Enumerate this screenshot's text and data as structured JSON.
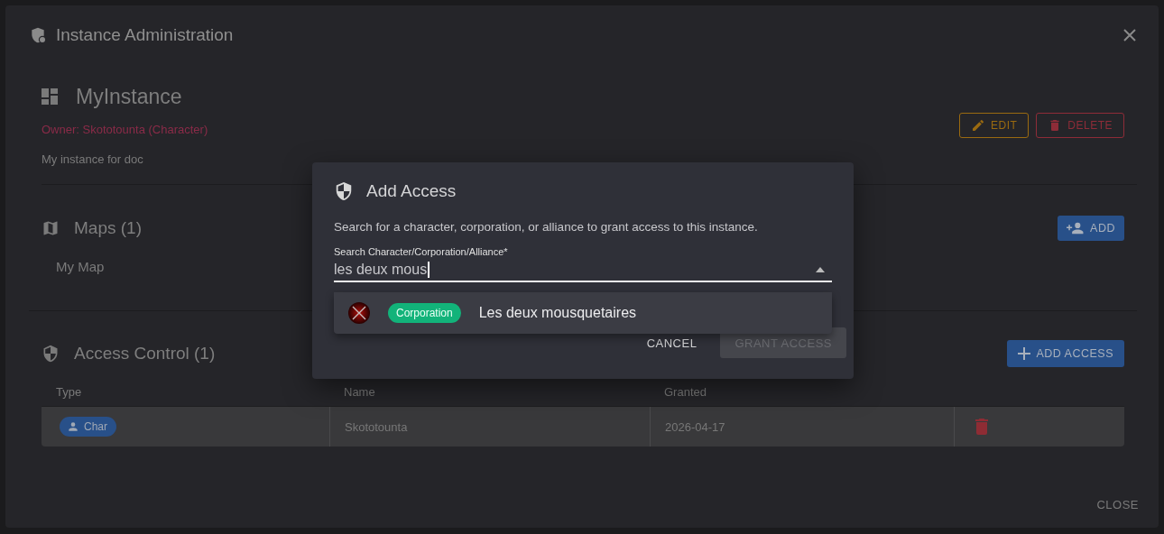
{
  "window": {
    "title": "Instance Administration"
  },
  "instance": {
    "name": "MyInstance",
    "owner": "Owner: Skototounta (Character)",
    "description": "My instance for doc",
    "buttons": [
      {
        "label": "EDIT",
        "kind": "edit"
      },
      {
        "label": "DELETE",
        "kind": "delete"
      }
    ]
  },
  "maps": {
    "title": "Maps (1)",
    "add_button": "ADD",
    "items": [
      {
        "name": "My Map"
      }
    ]
  },
  "access_control": {
    "title": "Access Control (1)",
    "add_button": "ADD ACCESS",
    "table": {
      "columns": [
        "Type",
        "Name",
        "Granted"
      ],
      "rows": [
        {
          "type": "Char",
          "name": "Skototounta",
          "granted": "2026-04-17"
        }
      ]
    }
  },
  "footer": {
    "close_button": "CLOSE"
  },
  "add_access_dialog": {
    "title": "Add Access",
    "description": "Search for a character, corporation, or alliance to grant access to this instance.",
    "search": {
      "label": "Search Character/Corporation/Alliance*",
      "value": "les deux mous",
      "expanded": true
    },
    "results": [
      {
        "type": "Corporation",
        "name": "Les deux mousquetaires"
      }
    ],
    "buttons": [
      {
        "label": "CANCEL",
        "disabled": false
      },
      {
        "label": "GRANT ACCESS",
        "disabled": true
      }
    ]
  }
}
